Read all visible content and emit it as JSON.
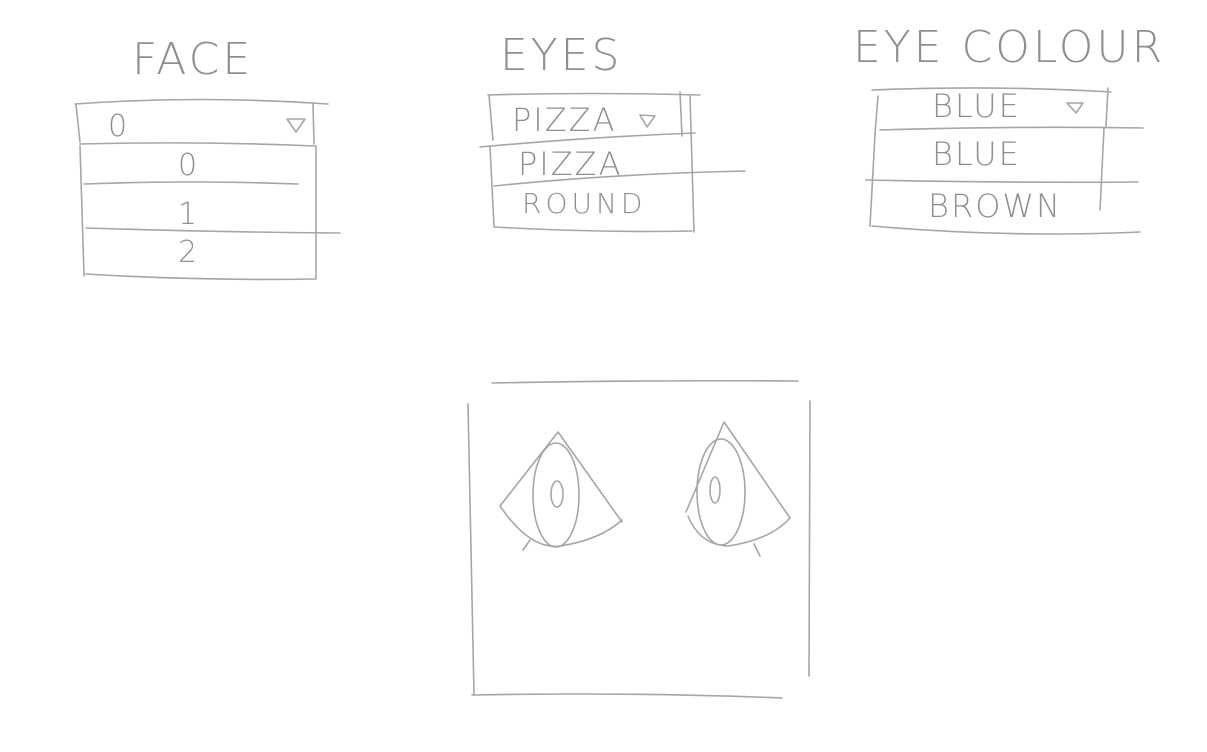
{
  "face": {
    "title": "FACE",
    "selected": "0",
    "options": [
      "0",
      "1",
      "2"
    ]
  },
  "eyes": {
    "title": "EYES",
    "selected": "PIZZA",
    "options": [
      "PIZZA",
      "ROUND"
    ]
  },
  "eye_colour": {
    "title": "EYE COLOUR",
    "selected": "BLUE",
    "options": [
      "BLUE",
      "BROWN"
    ]
  },
  "icons": {
    "dropdown": "triangle-down-icon"
  },
  "colors": {
    "ink": "#a6a6a6",
    "background": "#ffffff"
  }
}
